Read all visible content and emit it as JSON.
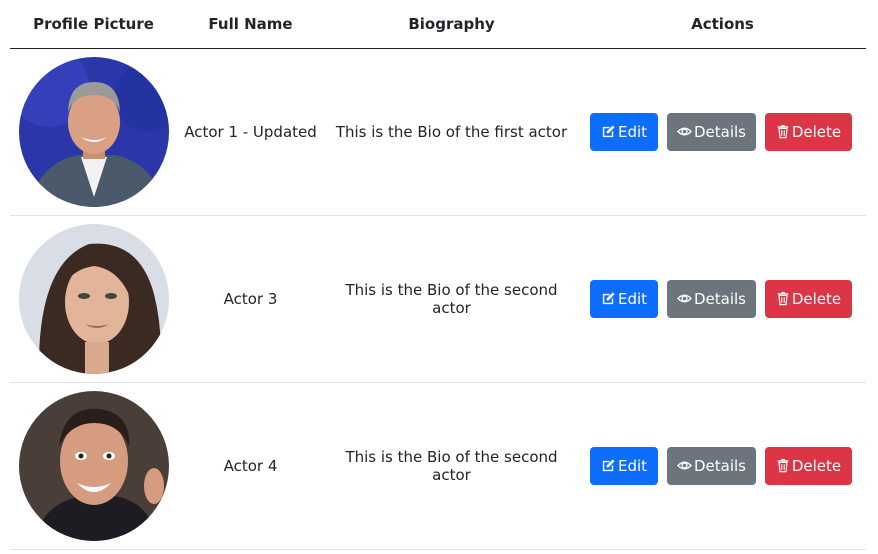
{
  "table": {
    "headers": {
      "picture": "Profile Picture",
      "name": "Full Name",
      "bio": "Biography",
      "actions": "Actions"
    },
    "rows": [
      {
        "avatar": "avatar-photo",
        "name": "Actor 1 - Updated",
        "bio": "This is the Bio of the first actor",
        "edit": "Edit",
        "details": "Details",
        "delete": "Delete"
      },
      {
        "avatar": "avatar-photo",
        "name": "Actor 3",
        "bio": "This is the Bio of the second actor",
        "edit": "Edit",
        "details": "Details",
        "delete": "Delete"
      },
      {
        "avatar": "avatar-photo",
        "name": "Actor 4",
        "bio": "This is the Bio of the second actor",
        "edit": "Edit",
        "details": "Details",
        "delete": "Delete"
      }
    ]
  },
  "icons": {
    "edit": "edit-icon",
    "details": "eye-icon",
    "delete": "trash-icon"
  },
  "colors": {
    "edit": "#0d6efd",
    "details": "#6c757d",
    "delete": "#dc3545"
  }
}
